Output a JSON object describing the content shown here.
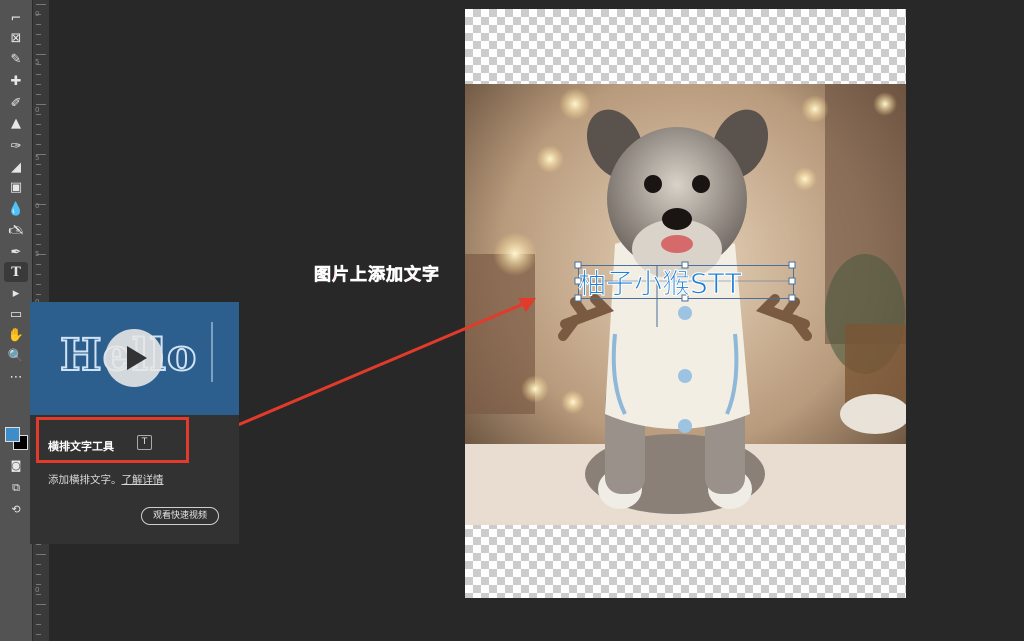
{
  "toolbar": {
    "tools": [
      {
        "name": "crop-tool-icon",
        "glyph": "⌐"
      },
      {
        "name": "frame-tool-icon",
        "glyph": "⊠"
      },
      {
        "name": "eyedropper-tool-icon",
        "glyph": "✎"
      },
      {
        "name": "healing-brush-tool-icon",
        "glyph": "✚"
      },
      {
        "name": "brush-tool-icon",
        "glyph": "✐"
      },
      {
        "name": "clone-stamp-tool-icon",
        "glyph": "▲"
      },
      {
        "name": "history-brush-tool-icon",
        "glyph": "✑"
      },
      {
        "name": "eraser-tool-icon",
        "glyph": "◢"
      },
      {
        "name": "gradient-tool-icon",
        "glyph": "▣"
      },
      {
        "name": "blur-tool-icon",
        "glyph": "💧"
      },
      {
        "name": "dodge-tool-icon",
        "glyph": "🖎"
      },
      {
        "name": "pen-tool-icon",
        "glyph": "✒"
      },
      {
        "name": "type-tool-icon",
        "glyph": "T"
      },
      {
        "name": "path-selection-tool-icon",
        "glyph": "▸"
      },
      {
        "name": "rectangle-tool-icon",
        "glyph": "▭"
      },
      {
        "name": "hand-tool-icon",
        "glyph": "✋"
      },
      {
        "name": "zoom-tool-icon",
        "glyph": "🔍"
      },
      {
        "name": "more-tools-icon",
        "glyph": "⋯"
      }
    ]
  },
  "ruler": {
    "labels": [
      "0",
      "5",
      "0",
      "5",
      "0",
      "5",
      "0",
      "5",
      "0",
      "5",
      "0",
      "5",
      "0"
    ]
  },
  "tooltip": {
    "video_word": "Hello",
    "title": "横排文字工具",
    "shortcut": "T",
    "desc": "添加横排文字。",
    "link": "了解详情",
    "button": "观看快速视频"
  },
  "annotation": {
    "text": "图片上添加文字"
  },
  "canvas": {
    "overlay_text": "柚子小猴STT"
  },
  "colors": {
    "accent_red": "#e23a2b",
    "text_blue": "#1a7fd6",
    "foreground": "#3c8dc8",
    "background": "#000000"
  }
}
